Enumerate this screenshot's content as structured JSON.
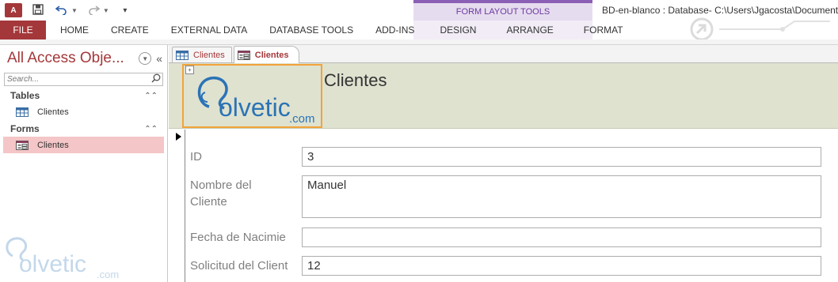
{
  "qat": {
    "app_icon": "A",
    "save_icon": "save-icon",
    "undo_icon": "undo-icon",
    "redo_icon": "redo-icon",
    "customize_icon": "customize-icon"
  },
  "contextual": {
    "group_label": "FORM LAYOUT TOOLS"
  },
  "window_title": "BD-en-blanco : Database- C:\\Users\\Jgacosta\\Documents",
  "ribbon_tabs": [
    {
      "label": "FILE"
    },
    {
      "label": "HOME"
    },
    {
      "label": "CREATE"
    },
    {
      "label": "EXTERNAL DATA"
    },
    {
      "label": "DATABASE TOOLS"
    },
    {
      "label": "ADD-INS"
    },
    {
      "label": "DESIGN"
    },
    {
      "label": "ARRANGE"
    },
    {
      "label": "FORMAT"
    }
  ],
  "nav": {
    "title": "All Access Obje...",
    "search_placeholder": "Search...",
    "groups": [
      {
        "name": "Tables",
        "items": [
          {
            "label": "Clientes"
          }
        ]
      },
      {
        "name": "Forms",
        "items": [
          {
            "label": "Clientes"
          }
        ]
      }
    ]
  },
  "doc_tabs": [
    {
      "label": "Clientes",
      "kind": "table"
    },
    {
      "label": "Clientes",
      "kind": "form"
    }
  ],
  "form": {
    "title": "Clientes",
    "logo_text": "olvetic",
    "logo_suffix": ".com",
    "fields": [
      {
        "label": "ID",
        "value": "3"
      },
      {
        "label": "Nombre del Cliente",
        "value": "Manuel"
      },
      {
        "label": "Fecha de Nacimie",
        "value": ""
      },
      {
        "label": "Solicitud del Client",
        "value": "12"
      }
    ]
  },
  "watermark": {
    "text": "olvetic",
    "suffix": ".com"
  },
  "colors": {
    "access_red": "#a4373a",
    "contextual_purple": "#8b5fb6",
    "form_header": "#dfe2cf",
    "selection_pink": "#f4c6c7",
    "logo_blue": "#2b73b6"
  }
}
